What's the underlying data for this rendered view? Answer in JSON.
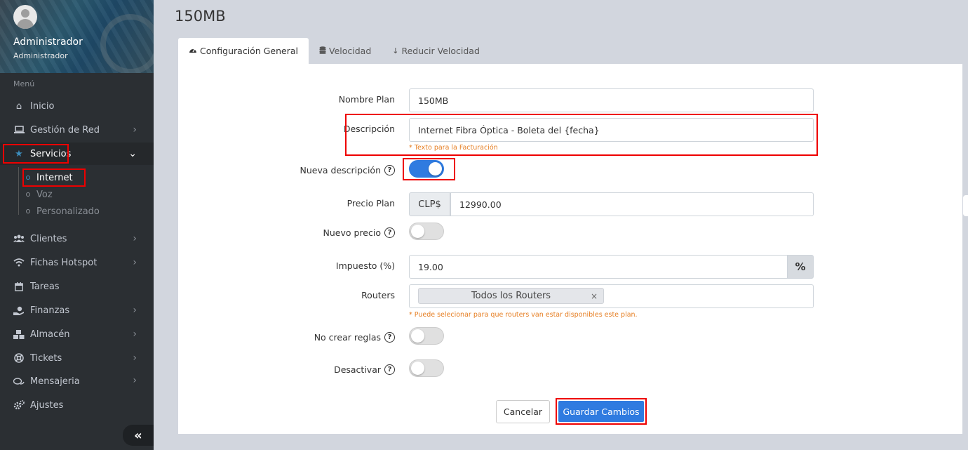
{
  "user": {
    "name": "Administrador",
    "role": "Administrador"
  },
  "sidebar": {
    "menu_header": "Menú",
    "items": [
      {
        "label": "Inicio",
        "icon": "home-icon"
      },
      {
        "label": "Gestión de Red",
        "icon": "laptop-icon"
      },
      {
        "label": "Servicios",
        "icon": "star-icon"
      },
      {
        "label": "Clientes",
        "icon": "users-icon"
      },
      {
        "label": "Fichas Hotspot",
        "icon": "wifi-icon"
      },
      {
        "label": "Tareas",
        "icon": "calendar-icon"
      },
      {
        "label": "Finanzas",
        "icon": "money-hand-icon"
      },
      {
        "label": "Almacén",
        "icon": "boxes-icon"
      },
      {
        "label": "Tickets",
        "icon": "lifebuoy-icon"
      },
      {
        "label": "Mensajeria",
        "icon": "chat-icon"
      },
      {
        "label": "Ajustes",
        "icon": "cogs-icon"
      }
    ],
    "servicios_sub": [
      "Internet",
      "Voz",
      "Personalizado"
    ]
  },
  "page": {
    "title": "150MB"
  },
  "tabs": [
    {
      "label": "Configuración General",
      "icon": "tachometer-icon"
    },
    {
      "label": "Velocidad",
      "icon": "database-icon"
    },
    {
      "label": "Reducir Velocidad",
      "icon": "arrow-down-icon"
    }
  ],
  "form": {
    "nombre_plan": {
      "label": "Nombre Plan",
      "value": "150MB"
    },
    "descripcion": {
      "label": "Descripción",
      "value": "Internet Fibra Óptica - Boleta del {fecha}",
      "hint": "* Texto para la Facturación"
    },
    "nueva_descripcion": {
      "label": "Nueva descripción",
      "enabled": true
    },
    "precio_plan": {
      "label": "Precio Plan",
      "currency": "CLP$",
      "value": "12990.00"
    },
    "nuevo_precio": {
      "label": "Nuevo precio",
      "enabled": false
    },
    "impuesto": {
      "label": "Impuesto (%)",
      "value": "19.00",
      "suffix": "%"
    },
    "routers": {
      "label": "Routers",
      "selected": "Todos los Routers",
      "remove": "×",
      "hint": "* Puede selecionar para que routers van estar disponibles este plan."
    },
    "no_crear_reglas": {
      "label": "No crear reglas",
      "enabled": false
    },
    "desactivar": {
      "label": "Desactivar",
      "enabled": false
    },
    "help_glyph": "?"
  },
  "buttons": {
    "cancel": "Cancelar",
    "save": "Guardar Cambios"
  },
  "collapse_glyph": "«"
}
